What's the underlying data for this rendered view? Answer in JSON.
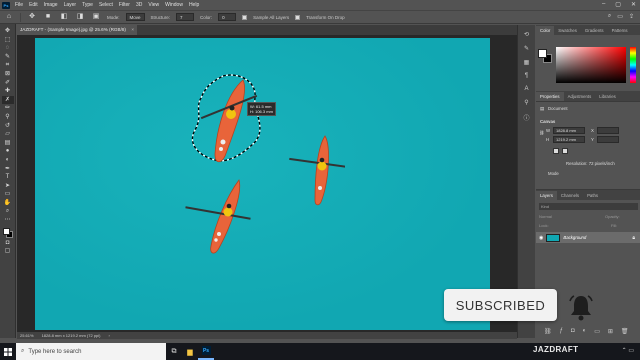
{
  "menubar": {
    "app_icon": "Ps",
    "items": [
      "File",
      "Edit",
      "Image",
      "Layer",
      "Type",
      "Select",
      "Filter",
      "3D",
      "View",
      "Window",
      "Help"
    ]
  },
  "options": {
    "mode_label": "Mode:",
    "mode_value": "Move",
    "structure_label": "Structure:",
    "structure_value": "7",
    "color_label": "Color:",
    "color_value": "0",
    "sample_all_layers": "Sample All Layers",
    "transform_on_drop": "Transform On Drop"
  },
  "document": {
    "tab_title": "JAZDRAFT - (Sample Image).jpg @ 25.6% (RGB/8)"
  },
  "canvas": {
    "measure": {
      "line1": "W: 61.5 mm",
      "line2": "H: 106.3 mm"
    },
    "colors": {
      "water": "#11a7b2",
      "kayak": "#e8643a"
    }
  },
  "statusbar": {
    "zoom": "25.61%",
    "doc_info": "1828.8 mm x 1219.2 mm (72 ppi)"
  },
  "color_panel": {
    "tabs": [
      "Color",
      "Swatches",
      "Gradients",
      "Patterns"
    ]
  },
  "properties": {
    "tabs": [
      "Properties",
      "Adjustments",
      "Libraries"
    ],
    "kind": "Document",
    "section": "Canvas",
    "w_label": "W",
    "w_value": "1828.8 mm",
    "h_label": "H",
    "h_value": "1219.2 mm",
    "x_label": "X",
    "y_label": "Y",
    "resolution": "Resolution: 72 pixels/inch",
    "mode": "Mode"
  },
  "layers": {
    "tabs": [
      "Layers",
      "Channels",
      "Paths"
    ],
    "filter": "Kind",
    "blend": "Normal",
    "opacity": "Opacity:",
    "lock": "Lock:",
    "fill": "Fill:",
    "layer_name": "Background"
  },
  "overlay": {
    "subscribe": "SUBSCRIBED"
  },
  "taskbar": {
    "search_placeholder": "Type here to search",
    "brand": "JAZDRAFT"
  }
}
